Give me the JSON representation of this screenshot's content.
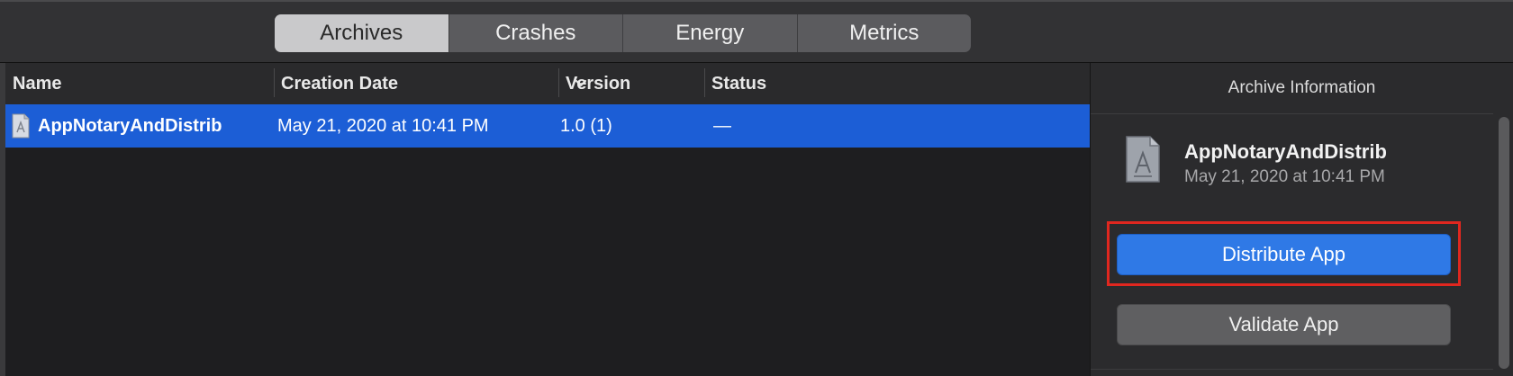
{
  "tabs": [
    {
      "label": "Archives",
      "active": true
    },
    {
      "label": "Crashes",
      "active": false
    },
    {
      "label": "Energy",
      "active": false
    },
    {
      "label": "Metrics",
      "active": false
    }
  ],
  "list": {
    "columns": [
      "Name",
      "Creation Date",
      "Version",
      "Status"
    ],
    "sort_icon": "chevron-down-icon",
    "rows": [
      {
        "name": "AppNotaryAndDistrib",
        "date": "May 21, 2020 at 10:41 PM",
        "version": "1.0 (1)",
        "status": "—",
        "icon": "archive-icon"
      }
    ]
  },
  "inspector": {
    "title": "Archive Information",
    "app_name": "AppNotaryAndDistrib",
    "app_date": "May 21, 2020 at 10:41 PM",
    "icon": "archive-icon",
    "distribute_label": "Distribute App",
    "validate_label": "Validate App"
  },
  "colors": {
    "selection": "#1c5ed6",
    "primary_button": "#2f79e6",
    "highlight_border": "#e0271f"
  }
}
